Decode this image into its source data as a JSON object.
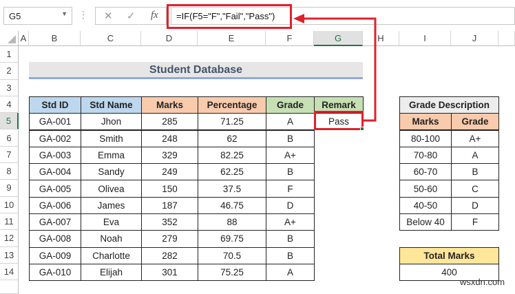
{
  "formula_bar": {
    "name_box": "G5",
    "formula": "=IF(F5=\"F\",\"Fail\",\"Pass\")",
    "cancel_icon": "✕",
    "enter_icon": "✓",
    "fx_label": "fx"
  },
  "columns": [
    "A",
    "B",
    "C",
    "D",
    "E",
    "F",
    "G",
    "H",
    "I",
    "J"
  ],
  "rows": [
    "1",
    "2",
    "3",
    "4",
    "5",
    "6",
    "7",
    "8",
    "9",
    "10",
    "11",
    "12",
    "13",
    "14"
  ],
  "title": "Student Database",
  "main_table": {
    "headers": [
      "Std ID",
      "Std Name",
      "Marks",
      "Percentage",
      "Grade",
      "Remark"
    ],
    "rows": [
      [
        "GA-001",
        "Jhon",
        "285",
        "71.25",
        "A",
        "Pass"
      ],
      [
        "GA-002",
        "Smith",
        "248",
        "62",
        "B"
      ],
      [
        "GA-003",
        "Emma",
        "329",
        "82.25",
        "A+"
      ],
      [
        "GA-004",
        "Sandy",
        "249",
        "62.25",
        "B"
      ],
      [
        "GA-005",
        "Olivea",
        "150",
        "37.5",
        "F"
      ],
      [
        "GA-006",
        "James",
        "187",
        "46.75",
        "D"
      ],
      [
        "GA-007",
        "Eva",
        "352",
        "88",
        "A+"
      ],
      [
        "GA-008",
        "Noah",
        "279",
        "69.75",
        "B"
      ],
      [
        "GA-009",
        "Charlotte",
        "282",
        "70.5",
        "B"
      ],
      [
        "GA-010",
        "Elijah",
        "301",
        "75.25",
        "A"
      ]
    ]
  },
  "grade_table": {
    "title": "Grade Description",
    "headers": [
      "Marks",
      "Grade"
    ],
    "rows": [
      [
        "80-100",
        "A+"
      ],
      [
        "70-80",
        "A"
      ],
      [
        "60-70",
        "B"
      ],
      [
        "50-60",
        "C"
      ],
      [
        "40-50",
        "D"
      ],
      [
        "Below 40",
        "F"
      ]
    ]
  },
  "total": {
    "label": "Total Marks",
    "value": "400"
  },
  "watermark": "wsxdn.com",
  "colors": {
    "blue_header": "#bdd7ee",
    "peach_header": "#f8cbad",
    "green_header": "#c6e0b4",
    "gray_header": "#ededed",
    "yellow_header": "#ffe699",
    "highlight": "#e0202a"
  }
}
